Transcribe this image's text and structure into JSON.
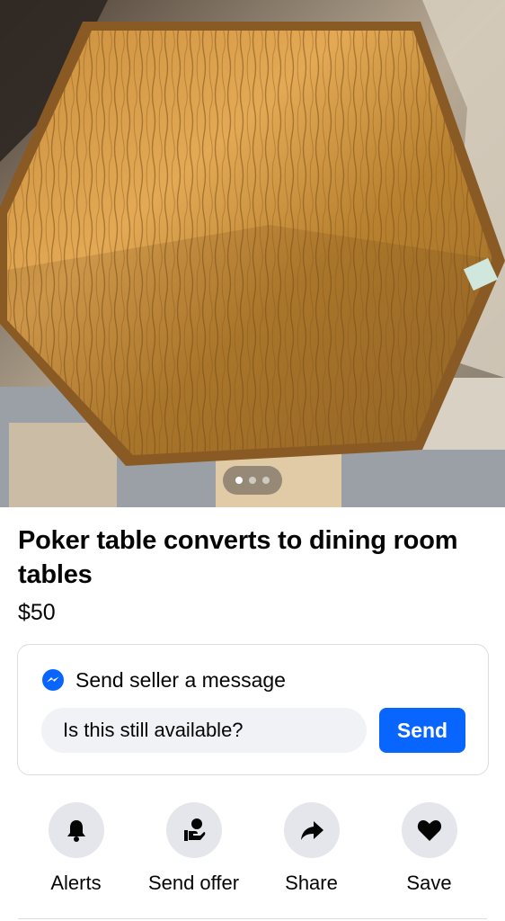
{
  "listing": {
    "title": "Poker table converts to dining room tables",
    "price": "$50",
    "photo": {
      "description_icon": "listing-photo",
      "carousel_count": 3,
      "carousel_active": 1
    }
  },
  "message": {
    "header": "Send seller a message",
    "header_icon": "messenger-icon",
    "input_value": "Is this still available?",
    "send_label": "Send"
  },
  "actions": [
    {
      "label": "Alerts",
      "icon": "bell-icon"
    },
    {
      "label": "Send offer",
      "icon": "send-offer-icon"
    },
    {
      "label": "Share",
      "icon": "share-arrow-icon"
    },
    {
      "label": "Save",
      "icon": "heart-icon"
    }
  ],
  "colors": {
    "accent": "#0866ff",
    "input_bg": "#f0f2f5",
    "circle_bg": "#e4e6eb"
  }
}
